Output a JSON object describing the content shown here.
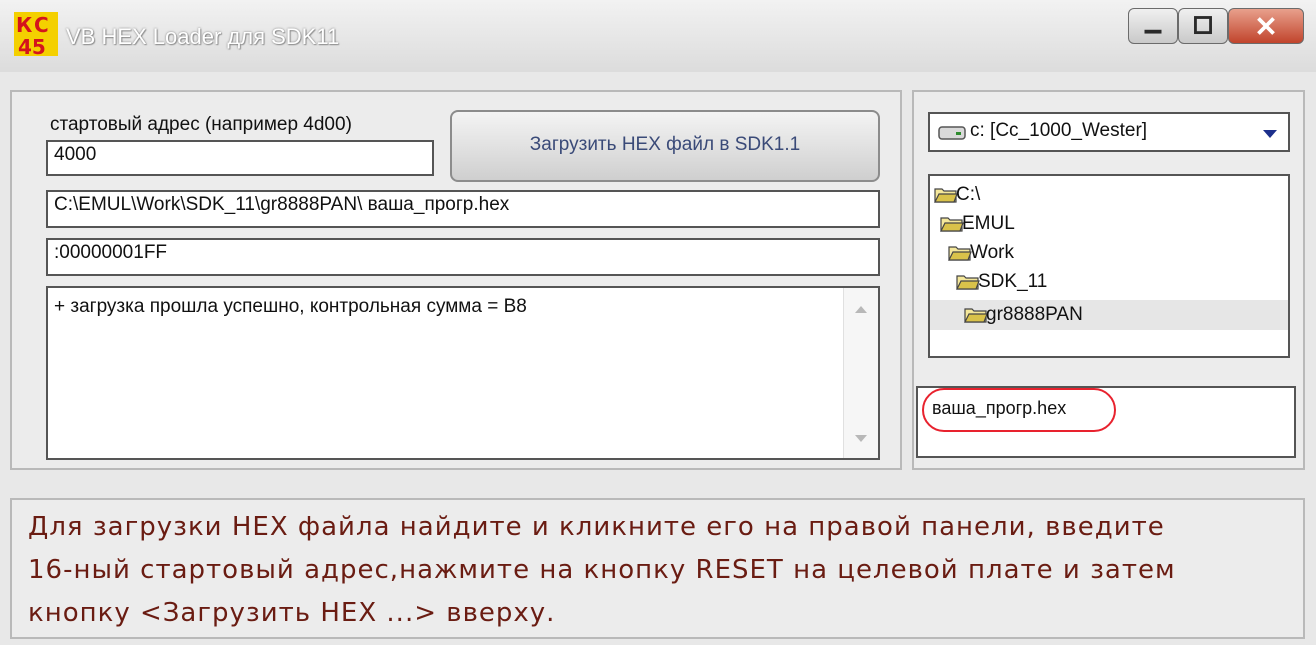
{
  "window": {
    "title": "VB HEX Loader для SDK11",
    "icon": "app-logo-icon",
    "controls": [
      "minimize-icon",
      "maximize-icon",
      "close-icon"
    ],
    "close_color": "#c1442c"
  },
  "left_panel": {
    "start_address_label": "стартовый адрес (например 4d00)",
    "start_address_value": "4000",
    "load_button_label": "Загрузить HEX файл в SDK1.1",
    "file_path": "C:\\EMUL\\Work\\SDK_11\\gr8888PAN\\ ваша_прогр.hex",
    "last_record": ":00000001FF",
    "log_text": "+  загрузка прошла успешно, контрольная сумма = B8"
  },
  "right_panel": {
    "drive_select": "c: [Cc_1000_Wester]",
    "directories": [
      "C:\\",
      "EMUL",
      "Work",
      "SDK_11",
      "gr8888PAN"
    ],
    "selected_directory": "gr8888PAN",
    "files": [
      "ваша_прогр.hex"
    ],
    "highlight_color": "#e8222e"
  },
  "instructions": {
    "line1": "Для загрузки HEX файла найдите и кликните его на правой панели, введите",
    "line2": "16-ный стартовый адрес,нажмите на кнопку RESET на целевой плате и затем",
    "line3": "кнопку <Загрузить HEX ...> вверху.",
    "color": "#6a1c12"
  }
}
